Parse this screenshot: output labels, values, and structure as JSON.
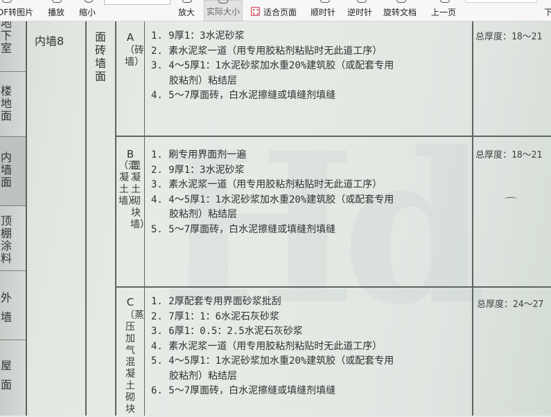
{
  "toolbar": {
    "items": [
      {
        "label": "DF转图片"
      },
      {
        "label": "播放"
      },
      {
        "label": "缩小"
      },
      {
        "label": "放大"
      },
      {
        "label": "实际大小"
      },
      {
        "label": "适合页面"
      },
      {
        "label": "顺时针"
      },
      {
        "label": "逆时针"
      },
      {
        "label": "旋转文档"
      },
      {
        "label": "上一页"
      },
      {
        "label": "下"
      }
    ],
    "active_item": "实际大小",
    "colors": {
      "fit_icon": "#d2384a",
      "active_bg": "#e2e2e2"
    }
  },
  "document": {
    "left_categories": [
      "地下室",
      "楼地面",
      "内墙面",
      "顶棚涂料",
      "外墙",
      "屋面"
    ],
    "highlighted_category": "内墙面",
    "room": "内墙8",
    "type": "面砖墙面",
    "variants": [
      {
        "letter": "A",
        "description": "（砖墙）",
        "steps": [
          "1. 9厚1：3水泥砂浆",
          "2. 素水泥浆一道（用专用胶粘剂粘贴时无此道工序）",
          "3. 4～5厚1：1水泥砂浆加水重20%建筑胶（或配套专用",
          "胶粘剂）粘结层",
          "4. 5～7厚面砖，白水泥擦缝或填缝剂填缝"
        ],
        "thickness": "总厚度：18～21"
      },
      {
        "letter": "B",
        "description_left": "（混凝土墙）",
        "description_right": "混凝土砌块墙）",
        "steps": [
          "1. 刷专用界面剂一遍",
          "2. 9厚1：3水泥砂浆",
          "3. 素水泥浆一道（用专用胶粘剂粘贴时无此道工序）",
          "4. 4～5厚1：1水泥砂浆加水重20%建筑胶（或配套专用",
          "胶粘剂）粘结层",
          "5. 5～7厚面砖，白水泥擦缝或填缝剂填缝"
        ],
        "thickness": "总厚度：18～21"
      },
      {
        "letter": "C",
        "description": "（蒸压加气混凝土砌块",
        "steps": [
          "1. 2厚配套专用界面砂浆批刮",
          "2. 7厚1：1：6水泥石灰砂浆",
          "3. 6厚1：0.5：2.5水泥石灰砂浆",
          "4. 素水泥浆一道（用专用胶粘剂粘贴时无此道工序）",
          "5. 4～5厚1：1水泥砂浆加水重20%建筑胶（或配套专用",
          "胶粘剂）粘结层",
          "6. 5～7厚面砖，白水泥擦缝或填缝剂填缝"
        ],
        "thickness": "总厚度：24～27"
      }
    ]
  }
}
